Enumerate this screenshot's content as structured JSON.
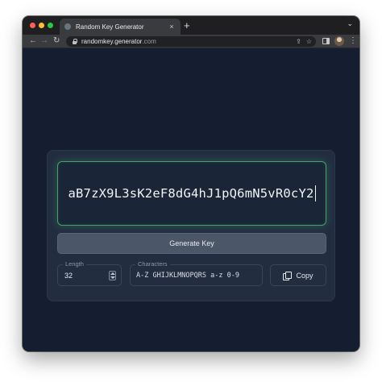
{
  "browser": {
    "tab_title": "Random Key Generator",
    "tab_close": "×",
    "new_tab": "+",
    "tab_menu": "⌄",
    "url_host": "randomkey.generator",
    "url_tld": ".com",
    "icons": {
      "back": "arrow-left-icon",
      "forward": "arrow-right-icon",
      "reload": "reload-icon",
      "share": "share-icon",
      "bookmark": "star-icon",
      "side_panel": "side-panel-icon",
      "profile": "avatar",
      "menu": "kebab-menu-icon"
    }
  },
  "generator": {
    "key": "aB7zX9L3sK2eF8dG4hJ1pQ6mN5vR0cY2",
    "generate_label": "Generate Key",
    "length_label": "Length",
    "length_value": "32",
    "characters_label": "Characters",
    "characters_value": "A-Z GHIJKLMNOPQRS a-z 0-9",
    "copy_label": "Copy"
  },
  "colors": {
    "page_bg": "#151e30",
    "card_bg": "#222e40",
    "accent_glow": "#3fa56a",
    "button_bg": "#4b5667"
  }
}
